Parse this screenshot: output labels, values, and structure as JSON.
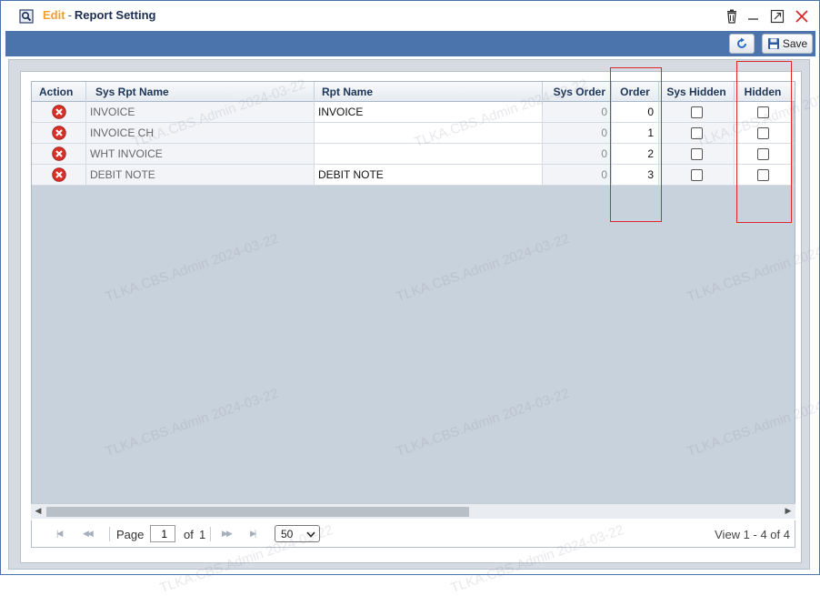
{
  "window": {
    "mode": "Edit",
    "separator": "-",
    "title": "Report Setting"
  },
  "toolbar": {
    "save_label": "Save"
  },
  "grid": {
    "columns": [
      "Action",
      "Sys Rpt Name",
      "Rpt Name",
      "Sys Order",
      "Order",
      "Sys Hidden",
      "Hidden"
    ],
    "rows": [
      {
        "sys_rpt_name": "INVOICE",
        "rpt_name": "INVOICE",
        "sys_order": "0",
        "order": "0",
        "sys_hidden": false,
        "hidden": false
      },
      {
        "sys_rpt_name": "INVOICE CH",
        "rpt_name": "",
        "sys_order": "0",
        "order": "1",
        "sys_hidden": false,
        "hidden": false
      },
      {
        "sys_rpt_name": "WHT INVOICE",
        "rpt_name": "",
        "sys_order": "0",
        "order": "2",
        "sys_hidden": false,
        "hidden": false
      },
      {
        "sys_rpt_name": "DEBIT NOTE",
        "rpt_name": "DEBIT NOTE",
        "sys_order": "0",
        "order": "3",
        "sys_hidden": false,
        "hidden": false
      }
    ]
  },
  "pager": {
    "page_label": "Page",
    "page_value": "1",
    "of_label": "of",
    "total_pages": "1",
    "page_size": "50",
    "view_text": "View 1 - 4 of 4"
  },
  "watermark": "TLKA.CBS.Admin 2024-03-22",
  "colors": {
    "title_edit": "#f0a030",
    "blue_band": "#4a74ab",
    "highlight": "#e0262a",
    "grid_empty": "#c8d2dc"
  },
  "icons": {
    "title": "magnifier-doc-icon",
    "delete_window": "trash-icon",
    "minimize": "minimize-icon",
    "maximize": "maximize-icon",
    "close": "close-icon",
    "refresh": "refresh-icon",
    "save": "floppy-icon",
    "row_delete": "delete-circle-icon"
  }
}
